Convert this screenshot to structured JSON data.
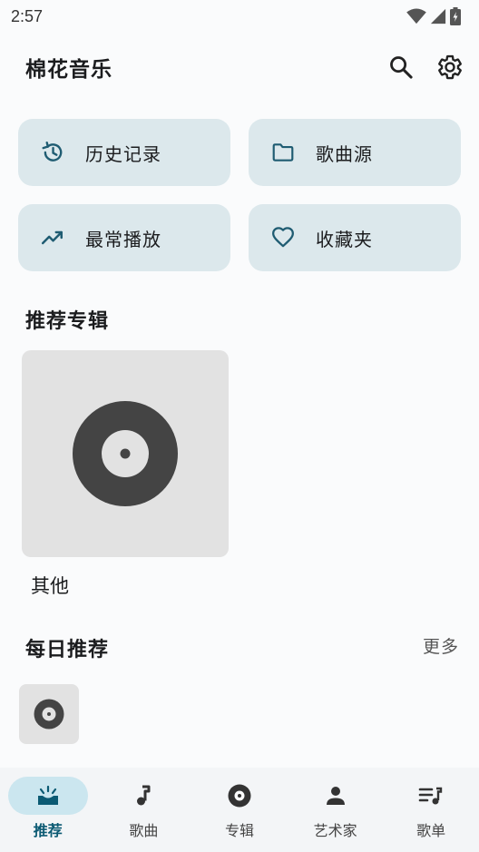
{
  "status_bar": {
    "time": "2:57"
  },
  "app_bar": {
    "title": "棉花音乐"
  },
  "quick_actions": [
    {
      "label": "历史记录",
      "icon": "history-icon"
    },
    {
      "label": "歌曲源",
      "icon": "folder-icon"
    },
    {
      "label": "最常播放",
      "icon": "trending-up-icon"
    },
    {
      "label": "收藏夹",
      "icon": "heart-icon"
    }
  ],
  "recommended_albums": {
    "title": "推荐专辑",
    "items": [
      {
        "name": "其他",
        "icon": "vinyl-disc-icon"
      }
    ]
  },
  "daily_recommend": {
    "title": "每日推荐",
    "more_label": "更多"
  },
  "bottom_nav": {
    "items": [
      {
        "label": "推荐",
        "icon": "recommend-icon",
        "active": true
      },
      {
        "label": "歌曲",
        "icon": "music-note-icon",
        "active": false
      },
      {
        "label": "专辑",
        "icon": "album-icon",
        "active": false
      },
      {
        "label": "艺术家",
        "icon": "person-icon",
        "active": false
      },
      {
        "label": "歌单",
        "icon": "playlist-icon",
        "active": false
      }
    ]
  },
  "colors": {
    "card_bg": "#dce8ec",
    "accent": "#0b5a73",
    "active_pill": "#cbe6ef",
    "vinyl": "#444444"
  }
}
